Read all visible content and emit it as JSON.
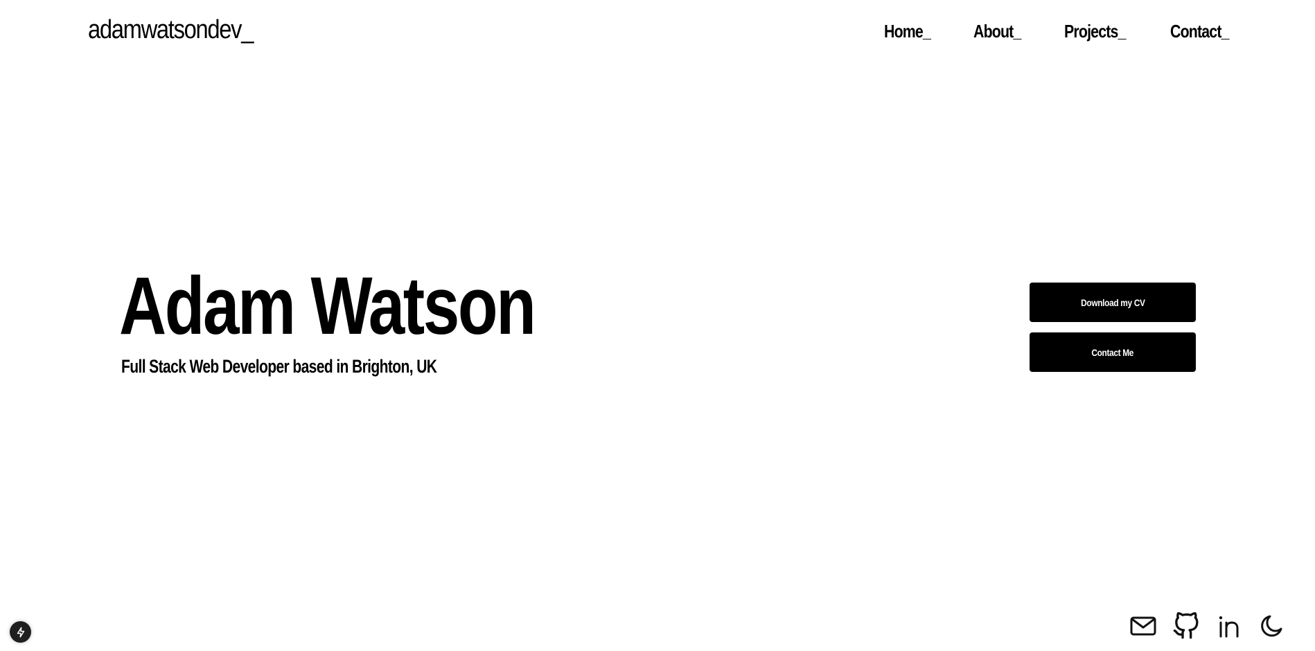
{
  "header": {
    "logo": "adamwatsondev_",
    "nav": [
      {
        "label": "Home_"
      },
      {
        "label": "About_"
      },
      {
        "label": "Projects_"
      },
      {
        "label": "Contact_"
      }
    ]
  },
  "hero": {
    "name": "Adam Watson",
    "subtitle": "Full Stack Web Developer based in Brighton, UK",
    "buttons": {
      "download_cv": "Download my CV",
      "contact_me": "Contact Me"
    }
  },
  "social": {
    "icons": [
      "mail-icon",
      "github-icon",
      "linkedin-icon",
      "moon-icon"
    ]
  },
  "badge": {
    "icon": "lightning-icon"
  },
  "colors": {
    "background": "#ffffff",
    "text": "#000000",
    "button_bg": "#000000",
    "button_text": "#ffffff"
  }
}
